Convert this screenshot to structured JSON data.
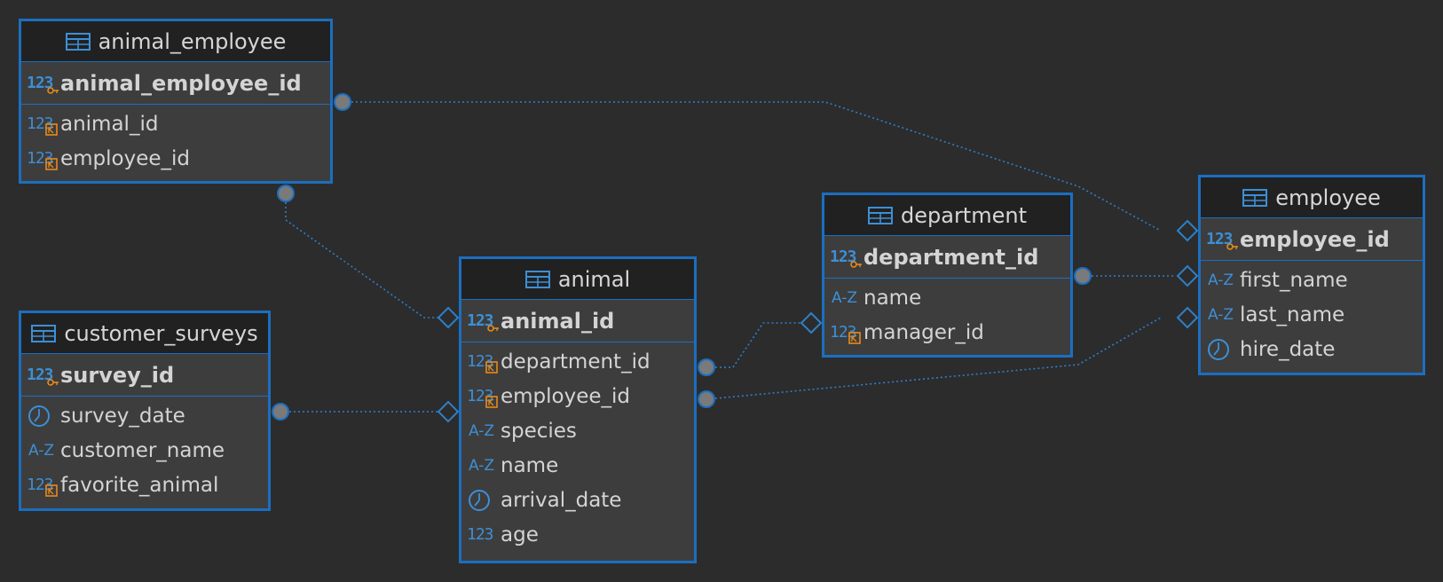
{
  "tables": [
    {
      "id": "animal_employee",
      "name": "animal_employee",
      "pk": [
        {
          "name": "animal_employee_id",
          "icon": "pk-number-icon"
        }
      ],
      "columns": [
        {
          "name": "animal_id",
          "icon": "fk-number-icon"
        },
        {
          "name": "employee_id",
          "icon": "fk-number-icon"
        }
      ]
    },
    {
      "id": "customer_surveys",
      "name": "customer_surveys",
      "pk": [
        {
          "name": "survey_id",
          "icon": "pk-number-icon"
        }
      ],
      "columns": [
        {
          "name": "survey_date",
          "icon": "clock-icon"
        },
        {
          "name": "customer_name",
          "icon": "text-icon"
        },
        {
          "name": "favorite_animal",
          "icon": "fk-number-icon"
        }
      ]
    },
    {
      "id": "animal",
      "name": "animal",
      "pk": [
        {
          "name": "animal_id",
          "icon": "pk-number-icon"
        }
      ],
      "columns": [
        {
          "name": "department_id",
          "icon": "fk-number-icon"
        },
        {
          "name": "employee_id",
          "icon": "fk-number-icon"
        },
        {
          "name": "species",
          "icon": "text-icon"
        },
        {
          "name": "name",
          "icon": "text-icon"
        },
        {
          "name": "arrival_date",
          "icon": "clock-icon"
        },
        {
          "name": "age",
          "icon": "number-icon"
        }
      ]
    },
    {
      "id": "department",
      "name": "department",
      "pk": [
        {
          "name": "department_id",
          "icon": "pk-number-icon"
        }
      ],
      "columns": [
        {
          "name": "name",
          "icon": "text-icon"
        },
        {
          "name": "manager_id",
          "icon": "fk-number-icon"
        }
      ]
    },
    {
      "id": "employee",
      "name": "employee",
      "pk": [
        {
          "name": "employee_id",
          "icon": "pk-number-icon"
        }
      ],
      "columns": [
        {
          "name": "first_name",
          "icon": "text-icon"
        },
        {
          "name": "last_name",
          "icon": "text-icon"
        },
        {
          "name": "hire_date",
          "icon": "clock-icon"
        }
      ]
    }
  ],
  "relationships": [
    {
      "from": "animal_employee.employee_id",
      "to": "employee.employee_id"
    },
    {
      "from": "animal_employee.animal_id",
      "to": "animal.animal_id"
    },
    {
      "from": "customer_surveys.favorite_animal",
      "to": "animal.animal_id"
    },
    {
      "from": "animal.department_id",
      "to": "department.department_id"
    },
    {
      "from": "animal.employee_id",
      "to": "employee.employee_id"
    },
    {
      "from": "department.manager_id",
      "to": "employee.employee_id"
    }
  ],
  "glyphs": {
    "number": "123",
    "text": "A-Z"
  },
  "colors": {
    "border": "#1b6fc0",
    "icon": "#3d8fd6",
    "key": "#e88a1a",
    "background": "#2c2c2c"
  }
}
